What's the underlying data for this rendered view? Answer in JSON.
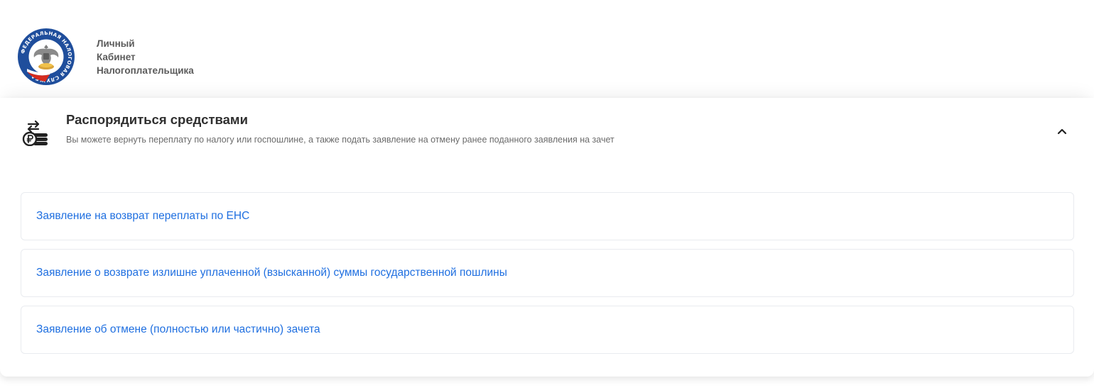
{
  "header": {
    "logo": {
      "icon": "fns-emblem-icon",
      "ring_text": "ФЕДЕРАЛЬНАЯ НАЛОГОВАЯ СЛУЖБА",
      "colors": {
        "ring": "#1f4e9c",
        "flag_white": "#ffffff",
        "flag_blue": "#1f4e9c",
        "flag_red": "#d52b1e"
      }
    },
    "brand": {
      "line1": "Личный",
      "line2": "Кабинет",
      "line3": "Налогоплательщика"
    }
  },
  "section": {
    "icon": "money-transfer-icon",
    "title": "Распорядиться средствами",
    "subtitle": "Вы можете вернуть переплату по налогу или госпошлине, а также подать заявление на отмену ранее поданного заявления на зачет",
    "toggle_icon": "chevron-up-icon",
    "expanded": true,
    "links": [
      {
        "label": "Заявление на возврат переплаты по ЕНС"
      },
      {
        "label": "Заявление о возврате излишне уплаченной (взысканной) суммы государственной пошлины"
      },
      {
        "label": "Заявление об отмене (полностью или частично) зачета"
      }
    ]
  },
  "colors": {
    "link": "#1f6fe0",
    "title": "#2f2f2f",
    "subtitle": "#6b6b6b",
    "brand_text": "#5b5b5b",
    "row_border": "#e9ebef"
  }
}
